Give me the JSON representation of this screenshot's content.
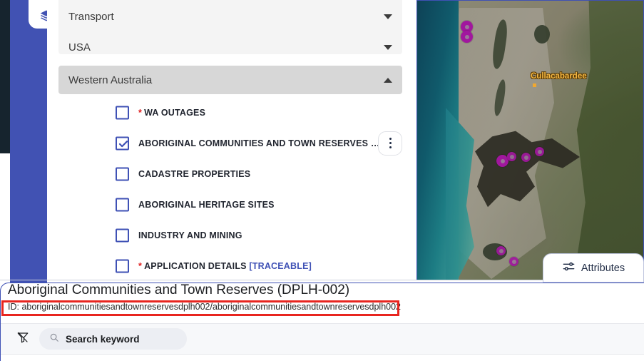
{
  "sidebar": {
    "layers_tab_icon": "layers-icon",
    "accent_color": "#4152b3",
    "dark_color": "#16242e"
  },
  "layer_groups": [
    {
      "label": "Transport",
      "expanded": false,
      "caret": "chevron-down-icon"
    },
    {
      "label": "USA",
      "expanded": false,
      "caret": "chevron-down-icon"
    },
    {
      "label": "Western Australia",
      "expanded": true,
      "caret": "chevron-up-icon"
    }
  ],
  "layers": [
    {
      "label": "WA OUTAGES",
      "checked": false,
      "required": true,
      "traceable": false,
      "menu": false
    },
    {
      "label": "ABORIGINAL COMMUNITIES AND TOWN RESERVES (DPLH-…",
      "checked": true,
      "required": false,
      "traceable": false,
      "menu": true
    },
    {
      "label": "CADASTRE PROPERTIES",
      "checked": false,
      "required": false,
      "traceable": false,
      "menu": false
    },
    {
      "label": "ABORIGINAL HERITAGE SITES",
      "checked": false,
      "required": false,
      "traceable": false,
      "menu": false
    },
    {
      "label": "INDUSTRY AND MINING",
      "checked": false,
      "required": false,
      "traceable": false,
      "menu": false
    },
    {
      "label": "APPLICATION DETAILS",
      "checked": false,
      "required": true,
      "traceable": true,
      "traceable_label": "[TRACEABLE]",
      "menu": false
    }
  ],
  "map": {
    "place_label": "Cullacabardee",
    "marker_color": "#a1179e",
    "attributes_tab": {
      "label": "Attributes",
      "icon": "sliders-icon"
    }
  },
  "bottom_panel": {
    "title": "Aboriginal Communities and Town Reserves (DPLH-002)",
    "id_text": "ID: aboriginalcommunitiesandtownreservesdplh002/aboriginalcommunitiesandtownreservesdplh002",
    "highlight_color": "#e8251f",
    "toolbar": {
      "filter_icon": "filter-icon",
      "search_icon": "search-icon",
      "search_placeholder": "Search keyword",
      "search_value": ""
    }
  }
}
